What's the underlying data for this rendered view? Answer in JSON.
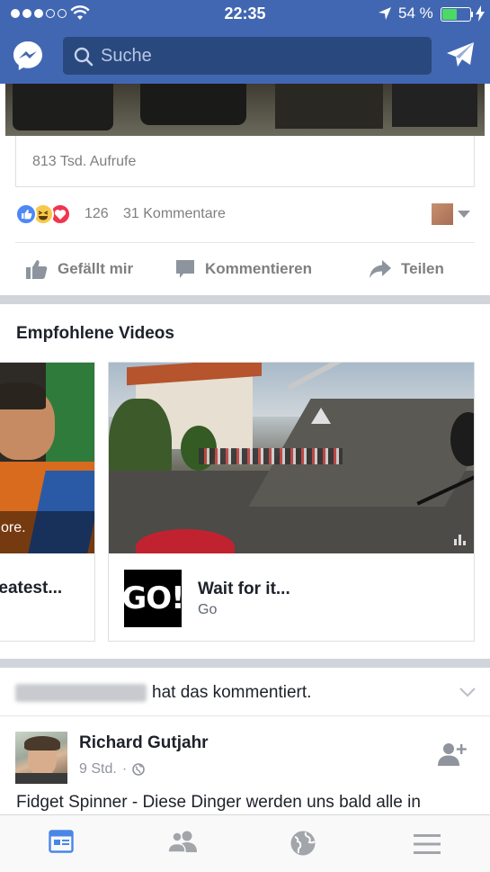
{
  "status_bar": {
    "time": "22:35",
    "battery_percent": "54 %",
    "battery_level": 0.54,
    "signal_bars_filled": 3,
    "signal_bars_total": 5
  },
  "nav": {
    "search_placeholder": "Suche"
  },
  "previous_post": {
    "views": "813 Tsd. Aufrufe",
    "reaction_count": "126",
    "comments": "31 Kommentare",
    "actions": {
      "like": "Gefällt mir",
      "comment": "Kommentieren",
      "share": "Teilen"
    }
  },
  "recommended": {
    "title": "Empfohlene Videos",
    "cards": [
      {
        "overlay_text": "ore.",
        "title": "reatest..."
      },
      {
        "title": "Wait for it...",
        "subtitle": "Go",
        "logo_text": "GO!"
      }
    ]
  },
  "story": {
    "activity_text": "hat das kommentiert.",
    "author": "Richard Gutjahr",
    "time": "9 Std.",
    "separator": "·",
    "text": "Fidget Spinner - Diese Dinger werden uns bald alle in"
  },
  "colors": {
    "brand": "#4267b2",
    "search_bg": "#29487d",
    "active_tab": "#4a86e8",
    "inactive_tab": "#a2a5aa"
  },
  "tab_bar": [
    "news-feed-icon",
    "friends-icon",
    "globe-icon",
    "menu-icon"
  ]
}
